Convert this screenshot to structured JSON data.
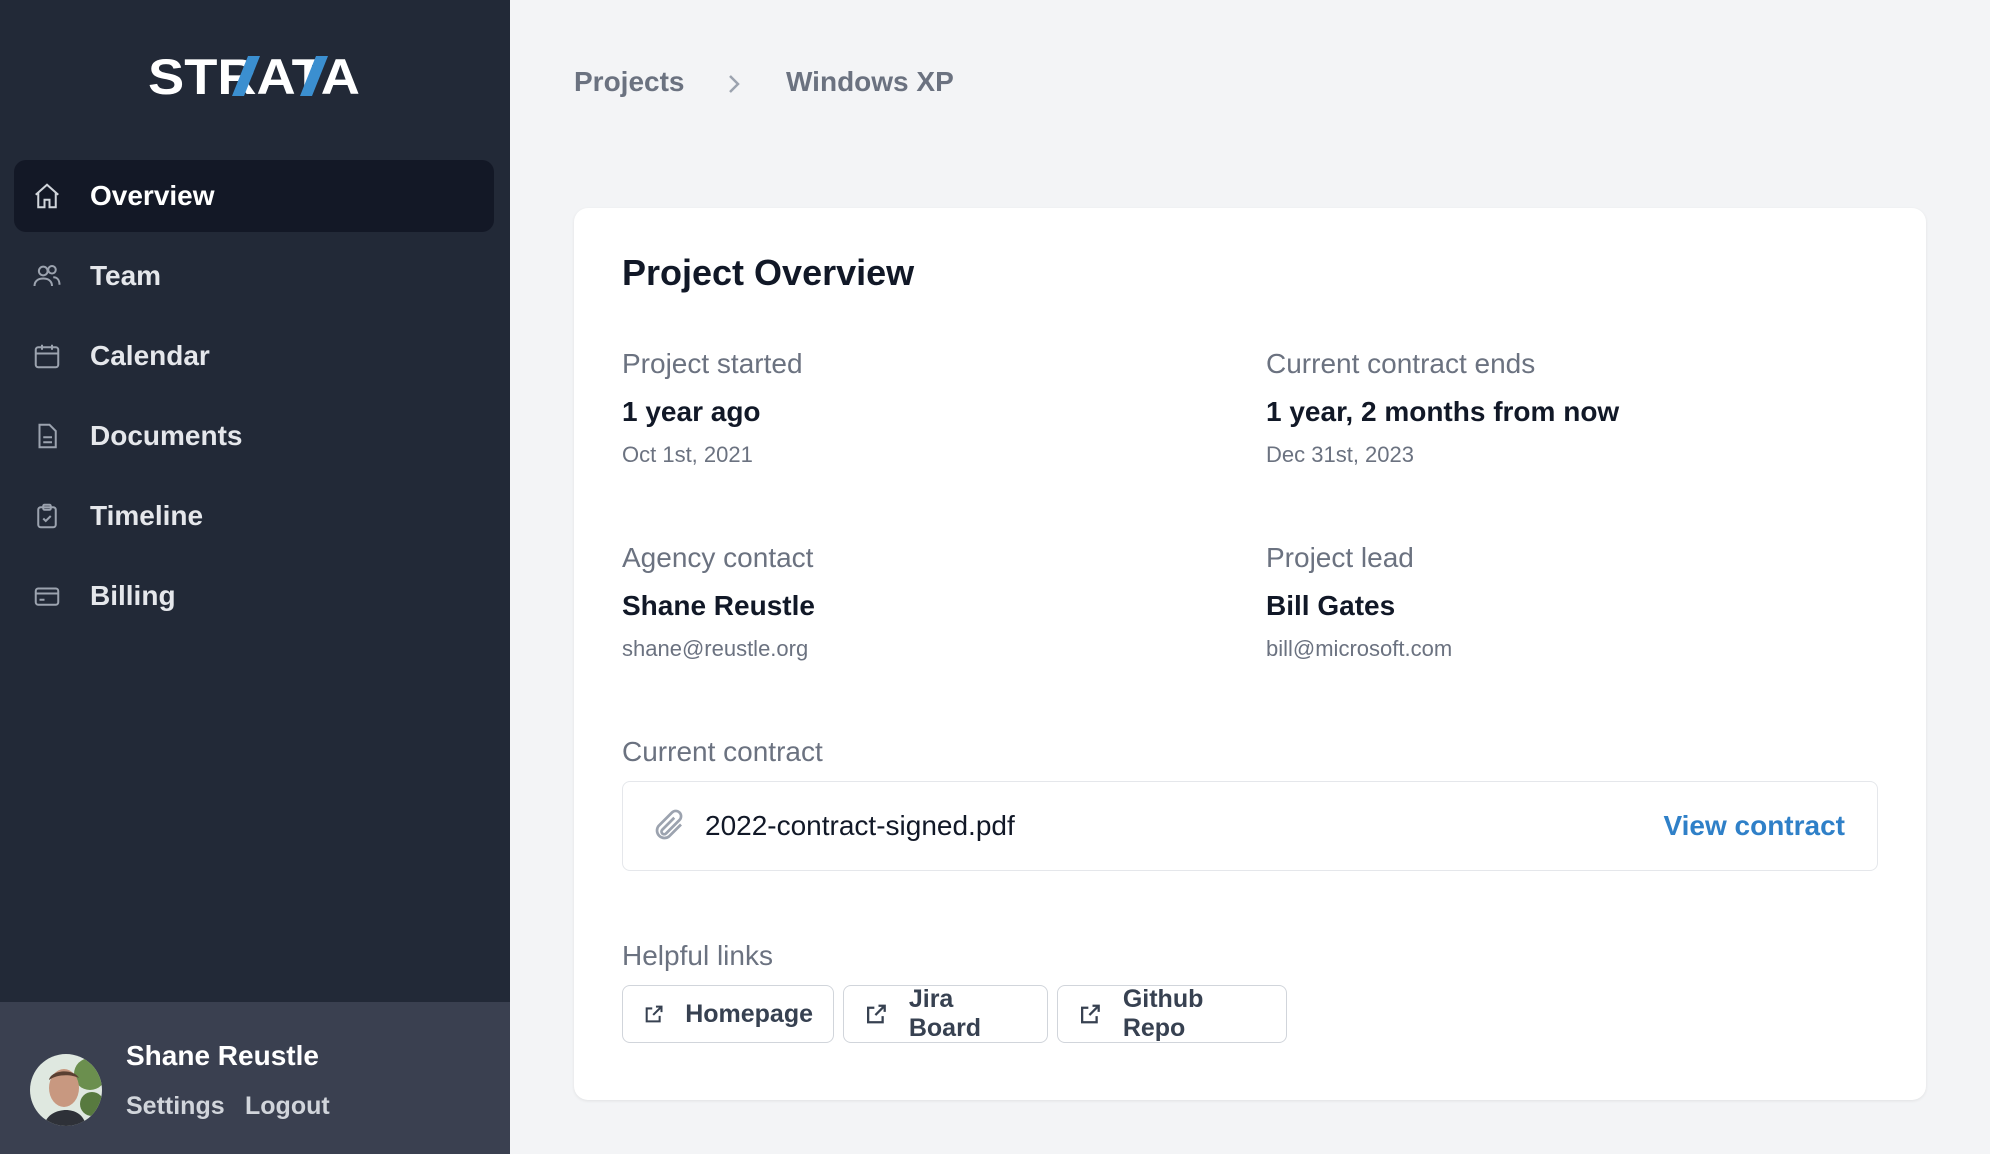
{
  "app": {
    "logo_text": "STRATA",
    "accent": "#3b8fd0"
  },
  "sidebar": {
    "items": [
      {
        "label": "Overview",
        "icon": "home-icon",
        "active": true
      },
      {
        "label": "Team",
        "icon": "users-icon"
      },
      {
        "label": "Calendar",
        "icon": "calendar-icon"
      },
      {
        "label": "Documents",
        "icon": "document-icon"
      },
      {
        "label": "Timeline",
        "icon": "clipboard-check-icon"
      },
      {
        "label": "Billing",
        "icon": "credit-card-icon"
      }
    ]
  },
  "user": {
    "name": "Shane Reustle",
    "settings": "Settings",
    "logout": "Logout"
  },
  "breadcrumb": {
    "parent": "Projects",
    "current": "Windows XP"
  },
  "card": {
    "title": "Project Overview",
    "started": {
      "label": "Project started",
      "value": "1 year ago",
      "sub": "Oct 1st, 2021"
    },
    "ends": {
      "label": "Current contract ends",
      "value": "1 year, 2 months from now",
      "sub": "Dec 31st, 2023"
    },
    "agency": {
      "label": "Agency contact",
      "value": "Shane Reustle",
      "sub": "shane@reustle.org"
    },
    "lead": {
      "label": "Project lead",
      "value": "Bill Gates",
      "sub": "bill@microsoft.com"
    },
    "contract": {
      "label": "Current contract",
      "file": "2022-contract-signed.pdf",
      "link": "View contract"
    },
    "links": {
      "label": "Helpful links",
      "items": [
        "Homepage",
        "Jira Board",
        "Github Repo"
      ]
    }
  }
}
